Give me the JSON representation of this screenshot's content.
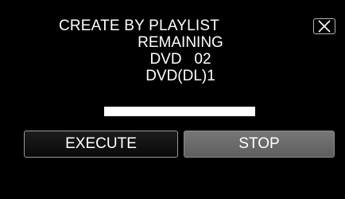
{
  "dialog": {
    "title": "CREATE BY PLAYLIST",
    "close_icon": "close-icon",
    "remaining_label": "REMAINING",
    "dvd_line": "DVD   02",
    "dvd_dl_line": "DVD(DL)1"
  },
  "progress": {
    "fraction": 1.0
  },
  "buttons": {
    "execute_label": "EXECUTE",
    "stop_label": "STOP"
  },
  "colors": {
    "background": "#000000",
    "text": "#ffffff",
    "stop_button": "#6b6b6b"
  }
}
